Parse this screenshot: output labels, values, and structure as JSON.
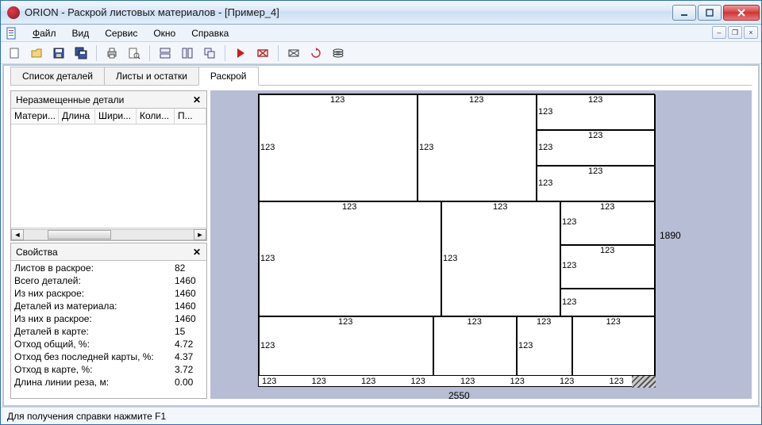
{
  "window": {
    "title": "ORION - Раскрой листовых материалов - [Пример_4]"
  },
  "menu": {
    "file": "Файл",
    "view": "Вид",
    "service": "Сервис",
    "window": "Окно",
    "help": "Справка"
  },
  "tabs": {
    "parts_list": "Список деталей",
    "sheets_remnants": "Листы и остатки",
    "cutting": "Раскрой"
  },
  "panel_unplaced": {
    "title": "Неразмещенные детали",
    "cols": {
      "material": "Матери...",
      "length": "Длина",
      "width": "Шири...",
      "qty": "Коли...",
      "last": "П..."
    }
  },
  "panel_props": {
    "title": "Свойства",
    "rows": [
      {
        "label": "Листов в раскрое:",
        "value": "82"
      },
      {
        "label": "Всего деталей:",
        "value": "1460"
      },
      {
        "label": "Из них раскрое:",
        "value": "1460"
      },
      {
        "label": "Деталей из материала:",
        "value": "1460"
      },
      {
        "label": "Из них в раскрое:",
        "value": "1460"
      },
      {
        "label": "Деталей в карте:",
        "value": "15"
      },
      {
        "label": "Отход общий, %:",
        "value": "4.72"
      },
      {
        "label": "Отход без последней карты, %:",
        "value": "4.37"
      },
      {
        "label": "Отход в карте, %:",
        "value": "3.72"
      },
      {
        "label": "Длина линии реза, м:",
        "value": "0.00"
      }
    ]
  },
  "sheet": {
    "width_label": "2550",
    "height_label": "1890",
    "piece_val": "123",
    "bottom_ticks": [
      "123",
      "123",
      "123",
      "123",
      "123",
      "123",
      "123",
      "123"
    ]
  },
  "statusbar": {
    "hint": "Для получения справки нажмите F1"
  }
}
